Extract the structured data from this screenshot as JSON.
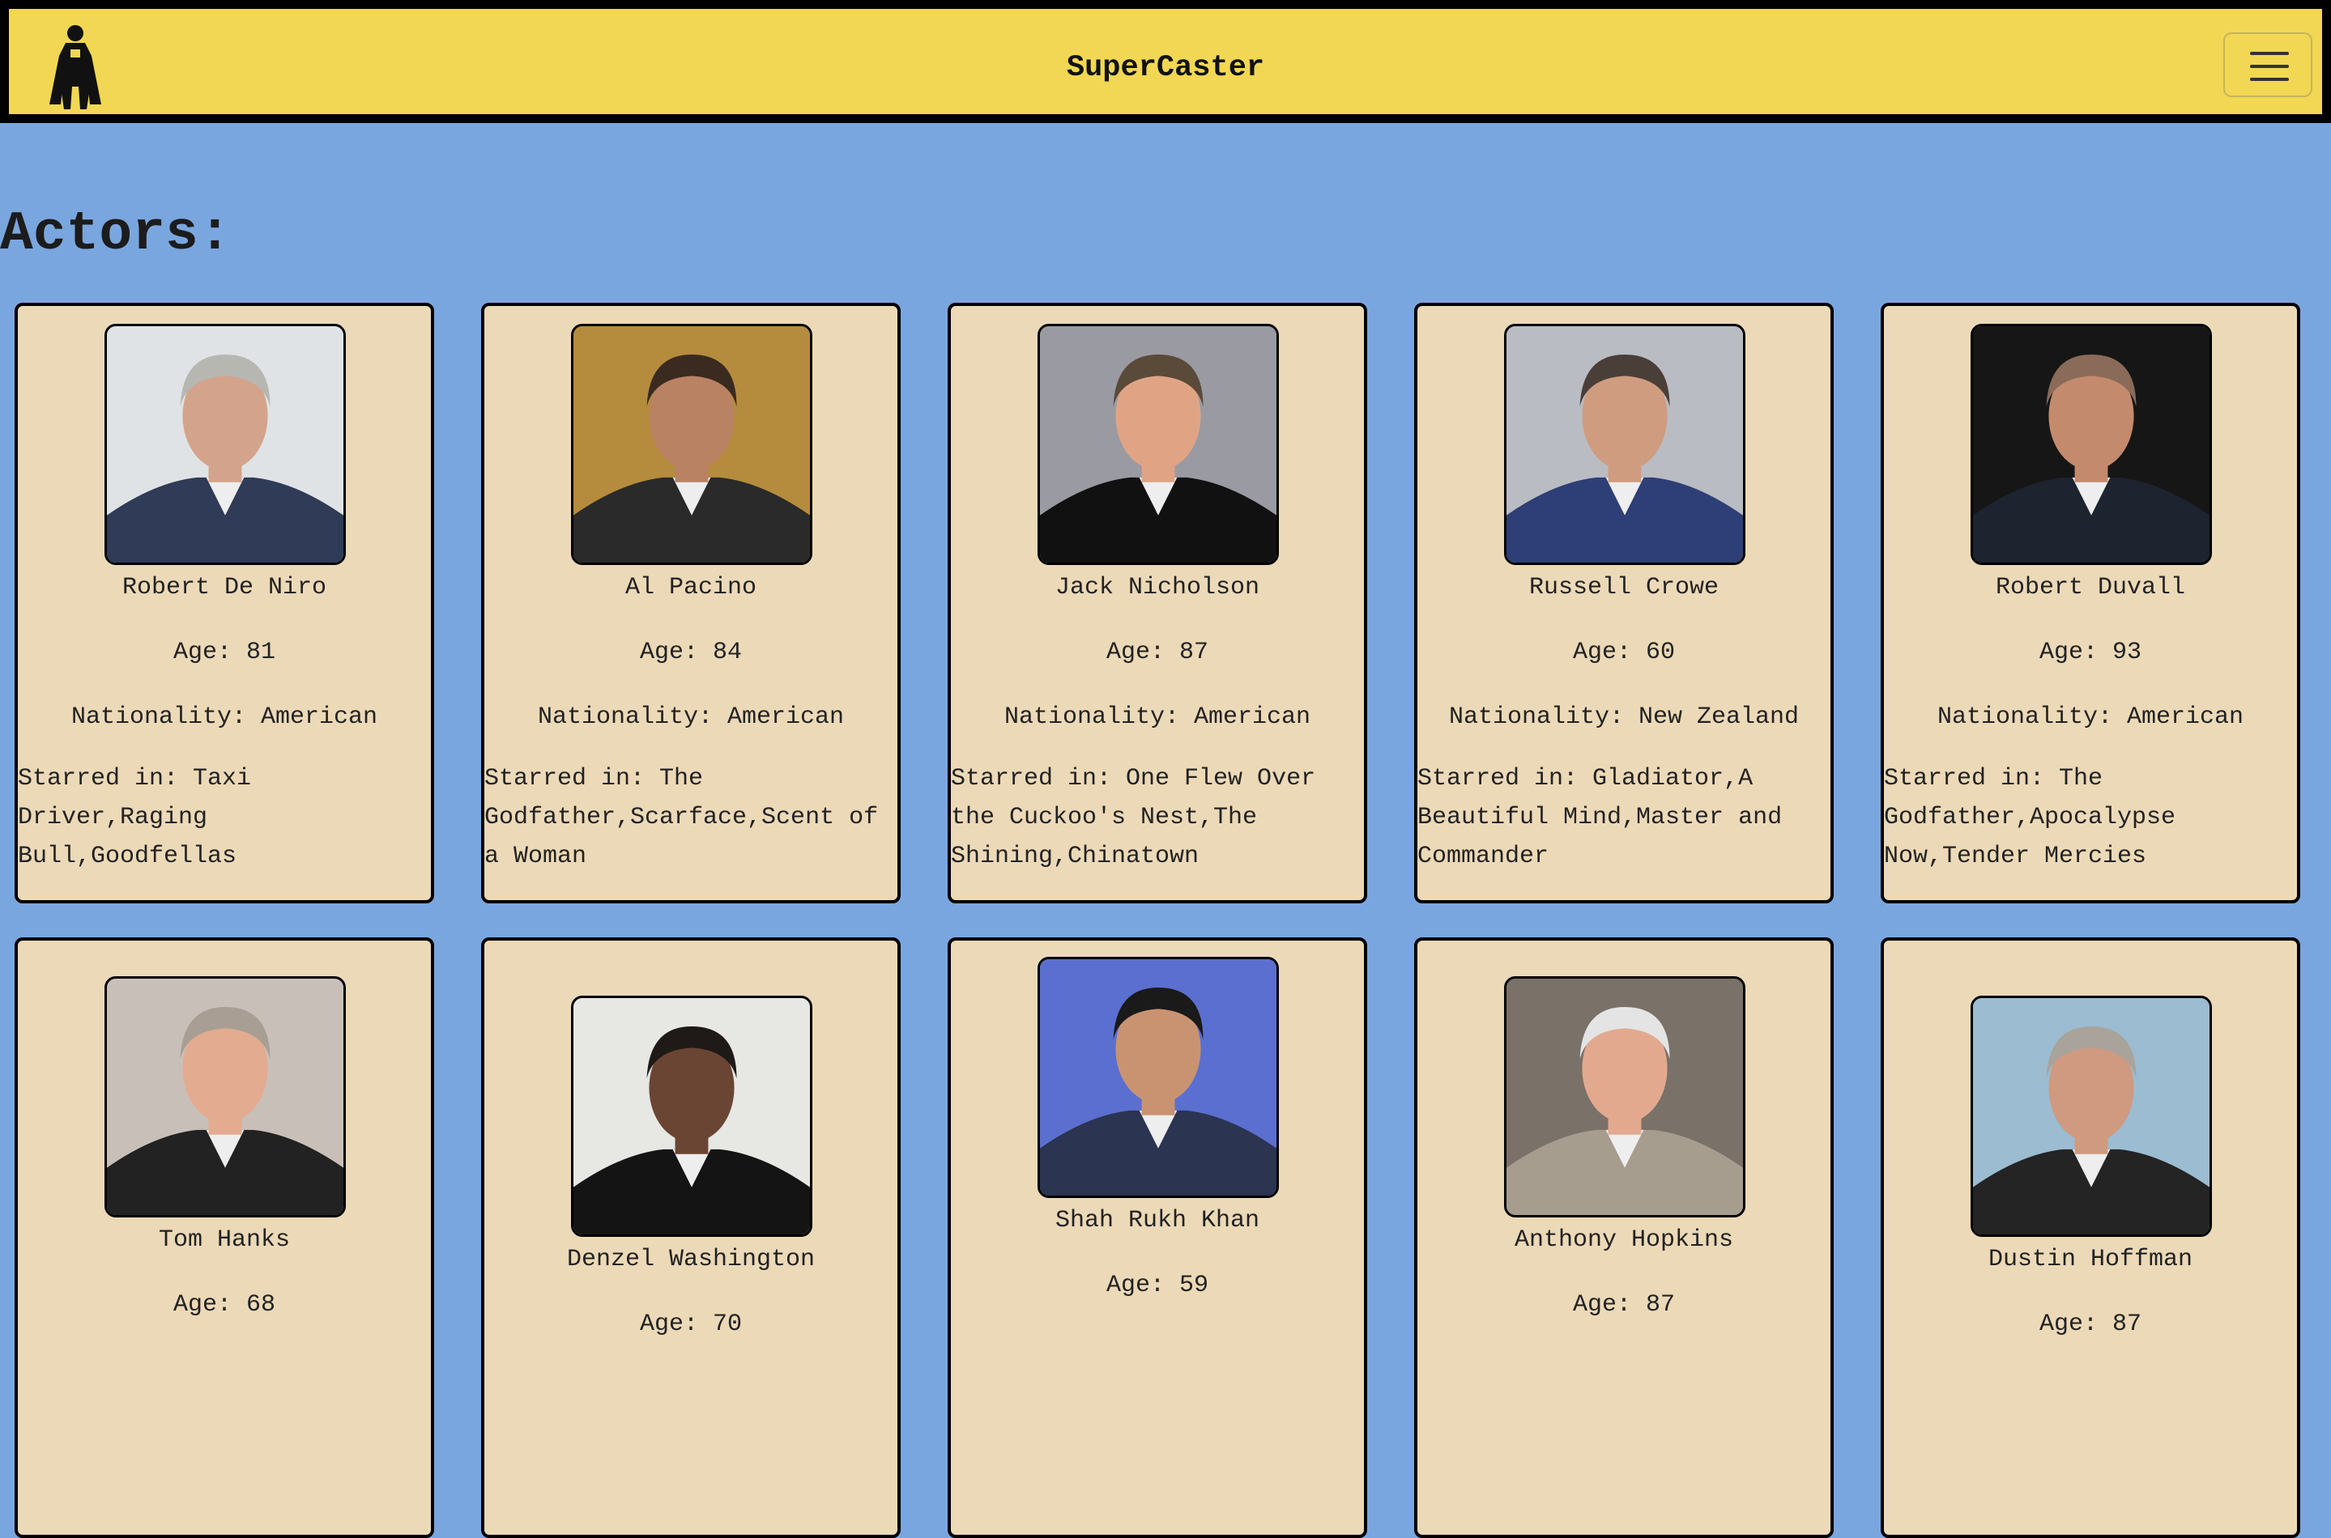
{
  "navbar": {
    "brand": "SuperCaster",
    "logo_icon": "hero-silhouette-icon",
    "menu_icon": "hamburger-menu-icon",
    "color": "#f1d753"
  },
  "page": {
    "heading": "Actors:",
    "background": "#7aa6df",
    "card_color": "#ecd9b7"
  },
  "actors": [
    {
      "name": "Robert De Niro",
      "age": "Age: 81",
      "nationality": "Nationality: American",
      "films": "Starred in: Taxi Driver,Raging Bull,Goodfellas",
      "bg": "#dfe3e6",
      "hair": "#b7b7b2",
      "skin": "#d3a48b",
      "suit": "#2f3b57"
    },
    {
      "name": "Al Pacino",
      "age": "Age: 84",
      "nationality": "Nationality: American",
      "films": "Starred in: The Godfather,Scarface,Scent of a Woman",
      "bg": "#b58c3d",
      "hair": "#3a2a20",
      "skin": "#b98263",
      "suit": "#2a2a2a"
    },
    {
      "name": "Jack Nicholson",
      "age": "Age: 87",
      "nationality": "Nationality: American",
      "films": "Starred in: One Flew Over the Cuckoo's Nest,The Shining,Chinatown",
      "bg": "#9a9aa2",
      "hair": "#5a4a3a",
      "skin": "#e0a485",
      "suit": "#111111"
    },
    {
      "name": "Russell Crowe",
      "age": "Age: 60",
      "nationality": "Nationality: New Zealand",
      "films": "Starred in: Gladiator,A Beautiful Mind,Master and Commander",
      "bg": "#b9bcc2",
      "hair": "#4a3f38",
      "skin": "#cf9c80",
      "suit": "#2d3f76"
    },
    {
      "name": "Robert Duvall",
      "age": "Age: 93",
      "nationality": "Nationality: American",
      "films": "Starred in: The Godfather,Apocalypse Now,Tender Mercies",
      "bg": "#161616",
      "hair": "#8a6a58",
      "skin": "#c48a6d",
      "suit": "#1e2330"
    },
    {
      "name": "Tom Hanks",
      "age": "Age: 68",
      "nationality": "",
      "films": "",
      "bg": "#c8c0b8",
      "hair": "#a89e94",
      "skin": "#e3ab90",
      "suit": "#222222"
    },
    {
      "name": "Denzel Washington",
      "age": "Age: 70",
      "nationality": "",
      "films": "",
      "bg": "#e7e7e4",
      "hair": "#1f1a17",
      "skin": "#6b4533",
      "suit": "#141414"
    },
    {
      "name": "Shah Rukh Khan",
      "age": "Age: 59",
      "nationality": "",
      "films": "",
      "bg": "#5b6fd0",
      "hair": "#1a1a1a",
      "skin": "#c99372",
      "suit": "#2b3450"
    },
    {
      "name": "Anthony Hopkins",
      "age": "Age: 87",
      "nationality": "",
      "films": "",
      "bg": "#7a7168",
      "hair": "#e4e4e4",
      "skin": "#e3a98f",
      "suit": "#a69d8f"
    },
    {
      "name": "Dustin Hoffman",
      "age": "Age: 87",
      "nationality": "",
      "films": "",
      "bg": "#9bbcd1",
      "hair": "#a9a39b",
      "skin": "#cf9a80",
      "suit": "#242424"
    }
  ]
}
